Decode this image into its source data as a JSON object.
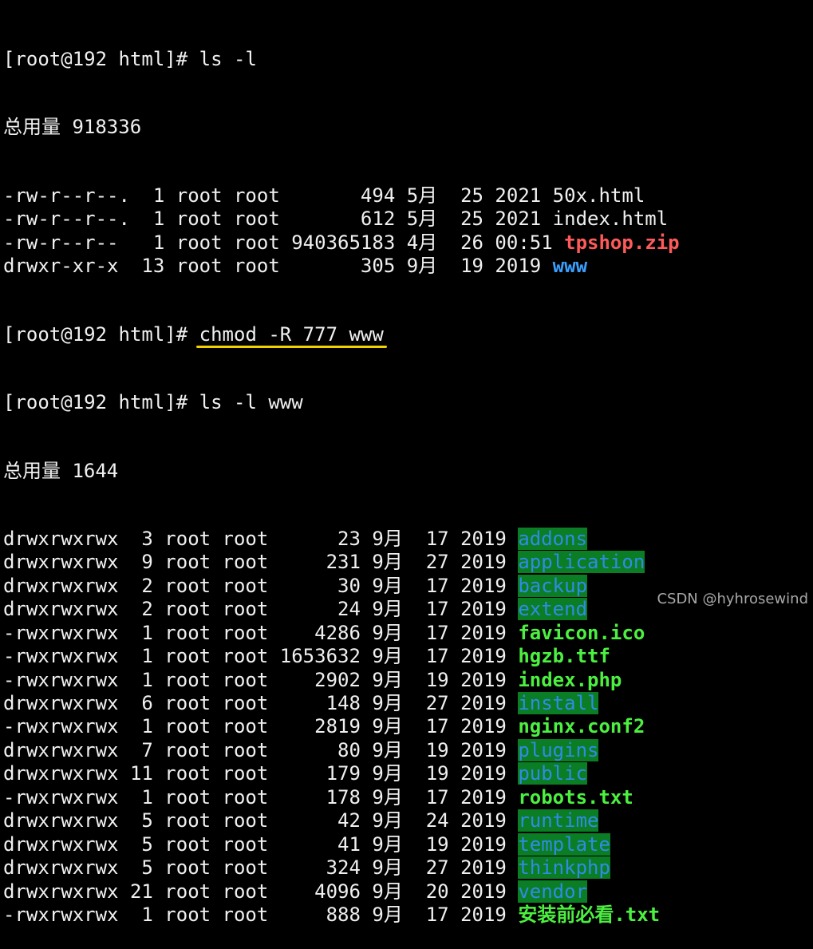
{
  "terminal": {
    "prompt1": "[root@192 html]# ",
    "cmd1": "ls -l",
    "total1": "总用量 918336",
    "list1": [
      {
        "meta": "-rw-r--r--.  1 root root       494 5月  25 2021 ",
        "name": "50x.html",
        "style": "plain"
      },
      {
        "meta": "-rw-r--r--.  1 root root       612 5月  25 2021 ",
        "name": "index.html",
        "style": "plain"
      },
      {
        "meta": "-rw-r--r--   1 root root 940365183 4月  26 00:51 ",
        "name": "tpshop.zip",
        "style": "red"
      },
      {
        "meta": "drwxr-xr-x  13 root root       305 9月  19 2019 ",
        "name": "www",
        "style": "blue"
      }
    ],
    "prompt2": "[root@192 html]# ",
    "cmd2": "chmod -R 777 www",
    "prompt3": "[root@192 html]# ",
    "cmd3": "ls -l www",
    "total2": "总用量 1644",
    "list2": [
      {
        "meta": "drwxrwxrwx  3 root root      23 9月  17 2019 ",
        "name": "addons",
        "style": "dir"
      },
      {
        "meta": "drwxrwxrwx  9 root root     231 9月  27 2019 ",
        "name": "application",
        "style": "dir"
      },
      {
        "meta": "drwxrwxrwx  2 root root      30 9月  17 2019 ",
        "name": "backup",
        "style": "dir"
      },
      {
        "meta": "drwxrwxrwx  2 root root      24 9月  17 2019 ",
        "name": "extend",
        "style": "dir"
      },
      {
        "meta": "-rwxrwxrwx  1 root root    4286 9月  17 2019 ",
        "name": "favicon.ico",
        "style": "exe"
      },
      {
        "meta": "-rwxrwxrwx  1 root root 1653632 9月  17 2019 ",
        "name": "hgzb.ttf",
        "style": "exe"
      },
      {
        "meta": "-rwxrwxrwx  1 root root    2902 9月  19 2019 ",
        "name": "index.php",
        "style": "exe"
      },
      {
        "meta": "drwxrwxrwx  6 root root     148 9月  27 2019 ",
        "name": "install",
        "style": "dir"
      },
      {
        "meta": "-rwxrwxrwx  1 root root    2819 9月  17 2019 ",
        "name": "nginx.conf2",
        "style": "exe"
      },
      {
        "meta": "drwxrwxrwx  7 root root      80 9月  19 2019 ",
        "name": "plugins",
        "style": "dir"
      },
      {
        "meta": "drwxrwxrwx 11 root root     179 9月  19 2019 ",
        "name": "public",
        "style": "dir"
      },
      {
        "meta": "-rwxrwxrwx  1 root root     178 9月  17 2019 ",
        "name": "robots.txt",
        "style": "exe"
      },
      {
        "meta": "drwxrwxrwx  5 root root      42 9月  24 2019 ",
        "name": "runtime",
        "style": "dir"
      },
      {
        "meta": "drwxrwxrwx  5 root root      41 9月  19 2019 ",
        "name": "template",
        "style": "dir"
      },
      {
        "meta": "drwxrwxrwx  5 root root     324 9月  27 2019 ",
        "name": "thinkphp",
        "style": "dir"
      },
      {
        "meta": "drwxrwxrwx 21 root root    4096 9月  20 2019 ",
        "name": "vendor",
        "style": "dir"
      },
      {
        "meta": "-rwxrwxrwx  1 root root     888 9月  17 2019 ",
        "name": "安装前必看.txt",
        "style": "exe"
      }
    ]
  },
  "watermark": "CSDN @hyhrosewind"
}
